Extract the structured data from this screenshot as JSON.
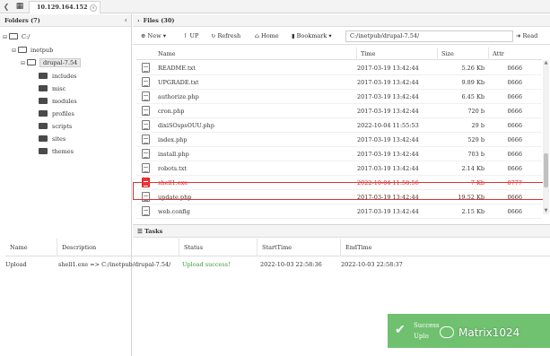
{
  "topbar": {
    "back_glyph": "❮",
    "grid_glyph": "▦",
    "tab_label": "10.129.164.152",
    "tab_close": "×"
  },
  "left": {
    "header": "Folders (7)",
    "collapse_glyph": "‹",
    "tree": [
      {
        "label": "C:/",
        "toggle": "⊟"
      },
      {
        "label": "inetpub",
        "toggle": "⊟"
      },
      {
        "label": "drupal-7.54",
        "toggle": "⊟"
      },
      {
        "label": "includes"
      },
      {
        "label": "misc"
      },
      {
        "label": "modules"
      },
      {
        "label": "profiles"
      },
      {
        "label": "scripts"
      },
      {
        "label": "sites"
      },
      {
        "label": "themes"
      }
    ]
  },
  "right": {
    "header": "Files (30)",
    "collapse_glyph": "›",
    "toolbar": {
      "new_label": "New",
      "up_label": "UP",
      "refresh_label": "Refresh",
      "home_label": "Home",
      "bookmark_label": "Bookmark",
      "path_value": "C:/inetpub/drupal-7.54/",
      "read_label": "Read"
    },
    "columns": {
      "name": "Name",
      "time": "Time",
      "size": "Size",
      "attr": "Attr"
    },
    "files": [
      {
        "name": "README.txt",
        "time": "2017-03-19 13:42:44",
        "size": "5.26 Kb",
        "attr": "0666"
      },
      {
        "name": "UPGRADE.txt",
        "time": "2017-03-19 13:42:44",
        "size": "9.89 Kb",
        "attr": "0666"
      },
      {
        "name": "authorize.php",
        "time": "2017-03-19 13:42:44",
        "size": "6.45 Kb",
        "attr": "0666"
      },
      {
        "name": "cron.php",
        "time": "2017-03-19 13:42:44",
        "size": "720 b",
        "attr": "0666"
      },
      {
        "name": "dixiSOspsOUU.php",
        "time": "2022-10-04 11:55:53",
        "size": "29 b",
        "attr": "0666"
      },
      {
        "name": "index.php",
        "time": "2017-03-19 13:42:44",
        "size": "529 b",
        "attr": "0666"
      },
      {
        "name": "install.php",
        "time": "2017-03-19 13:42:44",
        "size": "703 b",
        "attr": "0666"
      },
      {
        "name": "robots.txt",
        "time": "2017-03-19 13:42:44",
        "size": "2.14 Kb",
        "attr": "0666"
      },
      {
        "name": "shell1.exe",
        "time": "2022-10-04 11:58:56",
        "size": "7 Kb",
        "attr": "0777",
        "highlight": true
      },
      {
        "name": "update.php",
        "time": "2017-03-19 13:42:44",
        "size": "19.52 Kb",
        "attr": "0666"
      },
      {
        "name": "web.config",
        "time": "2017-03-19 13:42:44",
        "size": "2.15 Kb",
        "attr": "0666"
      }
    ],
    "highlight_color": "#dd2222"
  },
  "tasks": {
    "header": "Tasks",
    "columns": {
      "name": "Name",
      "description": "Description",
      "status": "Status",
      "start": "StartTime",
      "end": "EndTime"
    },
    "rows": [
      {
        "name": "Upload",
        "description": "shell1.exe => C:/inetpub/drupal-7.54/",
        "status": "Upload success!",
        "start": "2022-10-03 22:58:36",
        "end": "2022-10-03 22:58:37"
      }
    ],
    "success_color": "#3a9a3a"
  },
  "toast": {
    "check_glyph": "✔",
    "title": "Success",
    "message": "Uplo"
  },
  "watermark": {
    "text": "Matrix1024"
  }
}
